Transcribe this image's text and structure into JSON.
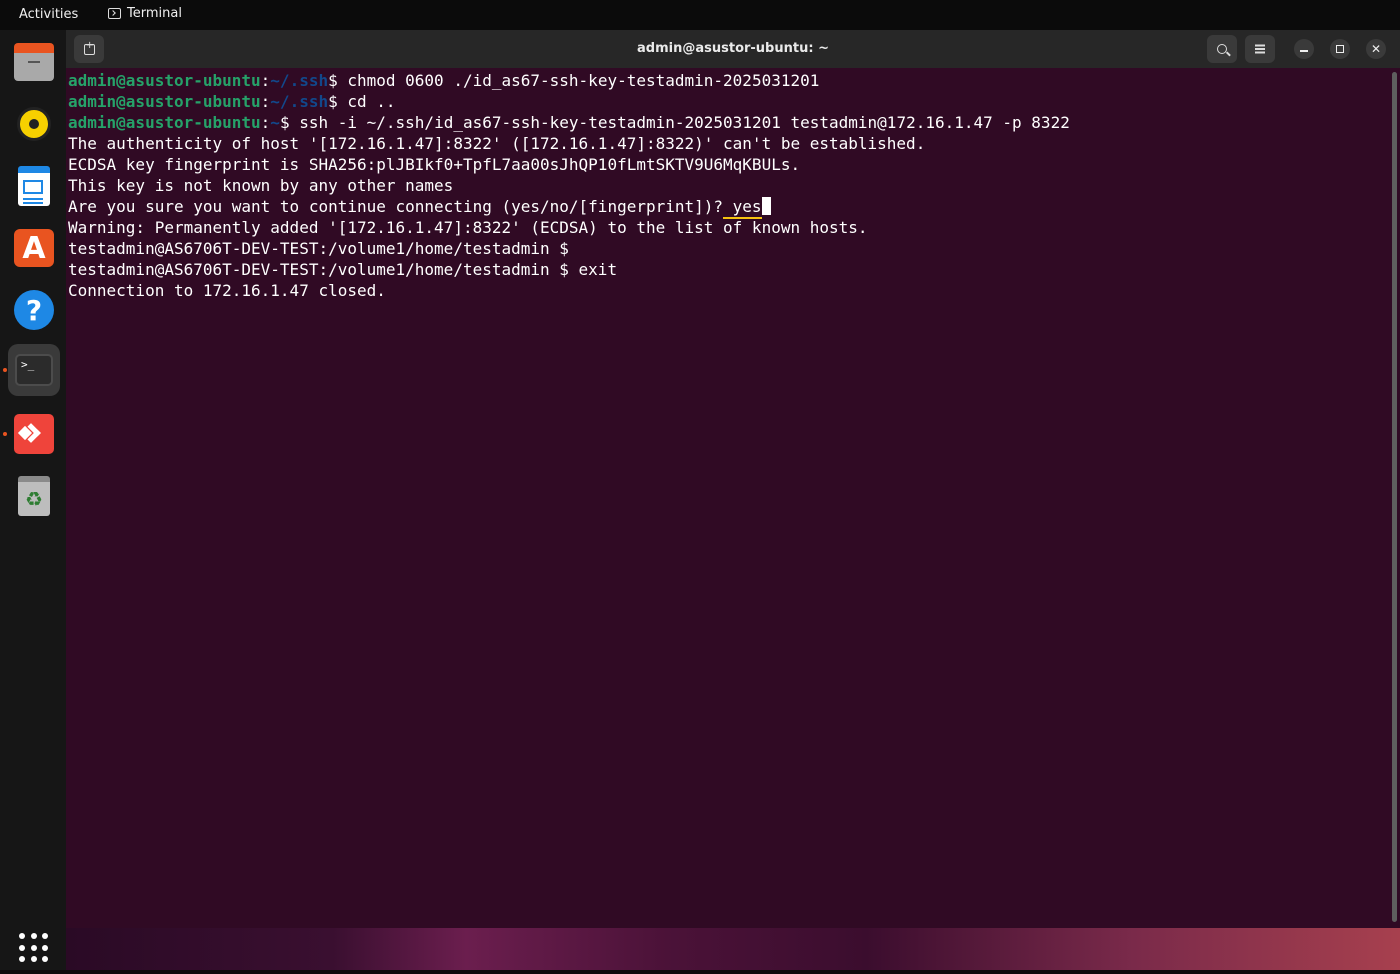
{
  "topbar": {
    "activities": "Activities",
    "app_name": "Terminal"
  },
  "dock": {
    "items": [
      {
        "name": "files",
        "icon": "files-icon"
      },
      {
        "name": "rhythmbox",
        "icon": "rhythmbox-icon"
      },
      {
        "name": "libreoffice-writer",
        "icon": "writer-icon"
      },
      {
        "name": "app-center",
        "icon": "app-store-icon",
        "glyph": "A"
      },
      {
        "name": "help",
        "icon": "help-icon",
        "glyph": "?"
      },
      {
        "name": "terminal",
        "icon": "terminal-icon",
        "glyph": ">_",
        "active": true
      },
      {
        "name": "anydesk",
        "icon": "anydesk-icon"
      },
      {
        "name": "trash",
        "icon": "trash-icon",
        "glyph": "♻"
      },
      {
        "name": "show-apps",
        "icon": "app-grid-icon"
      }
    ]
  },
  "window": {
    "title": "admin@asustor-ubuntu: ~"
  },
  "terminal": {
    "lines": [
      {
        "user": "admin@asustor-ubuntu",
        "sep": ":",
        "path": "~/.ssh",
        "prompt": "$ ",
        "cmd": "chmod 0600 ./id_as67-ssh-key-testadmin-2025031201"
      },
      {
        "user": "admin@asustor-ubuntu",
        "sep": ":",
        "path": "~/.ssh",
        "prompt": "$ ",
        "cmd": "cd .."
      },
      {
        "user": "admin@asustor-ubuntu",
        "sep": ":",
        "path": "~",
        "prompt": "$ ",
        "cmd": "ssh -i ~/.ssh/id_as67-ssh-key-testadmin-2025031201 testadmin@172.16.1.47 -p 8322"
      },
      {
        "text": "The authenticity of host '[172.16.1.47]:8322' ([172.16.1.47]:8322)' can't be established."
      },
      {
        "text": "ECDSA key fingerprint is SHA256:plJBIkf0+TpfL7aa00sJhQP10fLmtSKTV9U6MqKBULs."
      },
      {
        "text": "This key is not known by any other names"
      },
      {
        "text": "Are you sure you want to continue connecting (yes/no/[fingerprint])?",
        "answer": " yes"
      },
      {
        "text": "Warning: Permanently added '[172.16.1.47]:8322' (ECDSA) to the list of known hosts."
      },
      {
        "text": "testadmin@AS6706T-DEV-TEST:/volume1/home/testadmin $"
      },
      {
        "text": "testadmin@AS6706T-DEV-TEST:/volume1/home/testadmin $ exit"
      },
      {
        "text": "Connection to 172.16.1.47 closed."
      }
    ]
  },
  "colors": {
    "terminal_bg": "#300a24",
    "prompt_user": "#26a269",
    "prompt_path": "#12488b",
    "accent": "#e95420",
    "highlight": "#f5c211"
  }
}
